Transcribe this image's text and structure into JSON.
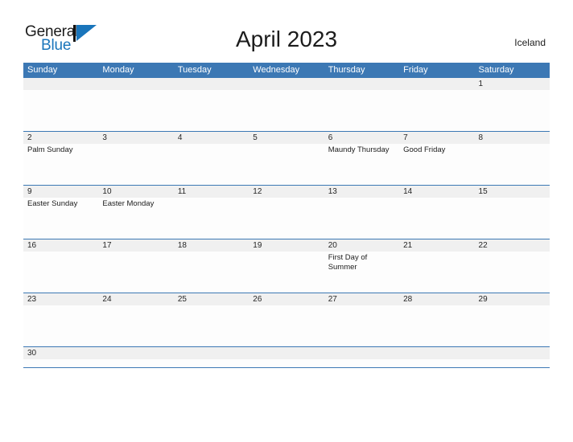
{
  "brand": {
    "word_one": "General",
    "word_two": "Blue",
    "logo_icon": "triangle-flag-icon",
    "accent_color": "#1a75bb"
  },
  "header": {
    "title": "April 2023",
    "country": "Iceland",
    "header_bar_color": "#3c78b4",
    "date_band_color": "#f0f0f0"
  },
  "calendar": {
    "weekdays": [
      "Sunday",
      "Monday",
      "Tuesday",
      "Wednesday",
      "Thursday",
      "Friday",
      "Saturday"
    ],
    "weeks": [
      [
        {
          "date": "",
          "events": []
        },
        {
          "date": "",
          "events": []
        },
        {
          "date": "",
          "events": []
        },
        {
          "date": "",
          "events": []
        },
        {
          "date": "",
          "events": []
        },
        {
          "date": "",
          "events": []
        },
        {
          "date": "1",
          "events": []
        }
      ],
      [
        {
          "date": "2",
          "events": [
            "Palm Sunday"
          ]
        },
        {
          "date": "3",
          "events": []
        },
        {
          "date": "4",
          "events": []
        },
        {
          "date": "5",
          "events": []
        },
        {
          "date": "6",
          "events": [
            "Maundy Thursday"
          ]
        },
        {
          "date": "7",
          "events": [
            "Good Friday"
          ]
        },
        {
          "date": "8",
          "events": []
        }
      ],
      [
        {
          "date": "9",
          "events": [
            "Easter Sunday"
          ]
        },
        {
          "date": "10",
          "events": [
            "Easter Monday"
          ]
        },
        {
          "date": "11",
          "events": []
        },
        {
          "date": "12",
          "events": []
        },
        {
          "date": "13",
          "events": []
        },
        {
          "date": "14",
          "events": []
        },
        {
          "date": "15",
          "events": []
        }
      ],
      [
        {
          "date": "16",
          "events": []
        },
        {
          "date": "17",
          "events": []
        },
        {
          "date": "18",
          "events": []
        },
        {
          "date": "19",
          "events": []
        },
        {
          "date": "20",
          "events": [
            "First Day of Summer"
          ]
        },
        {
          "date": "21",
          "events": []
        },
        {
          "date": "22",
          "events": []
        }
      ],
      [
        {
          "date": "23",
          "events": []
        },
        {
          "date": "24",
          "events": []
        },
        {
          "date": "25",
          "events": []
        },
        {
          "date": "26",
          "events": []
        },
        {
          "date": "27",
          "events": []
        },
        {
          "date": "28",
          "events": []
        },
        {
          "date": "29",
          "events": []
        }
      ],
      [
        {
          "date": "30",
          "events": []
        },
        {
          "date": "",
          "events": []
        },
        {
          "date": "",
          "events": []
        },
        {
          "date": "",
          "events": []
        },
        {
          "date": "",
          "events": []
        },
        {
          "date": "",
          "events": []
        },
        {
          "date": "",
          "events": []
        }
      ]
    ]
  }
}
